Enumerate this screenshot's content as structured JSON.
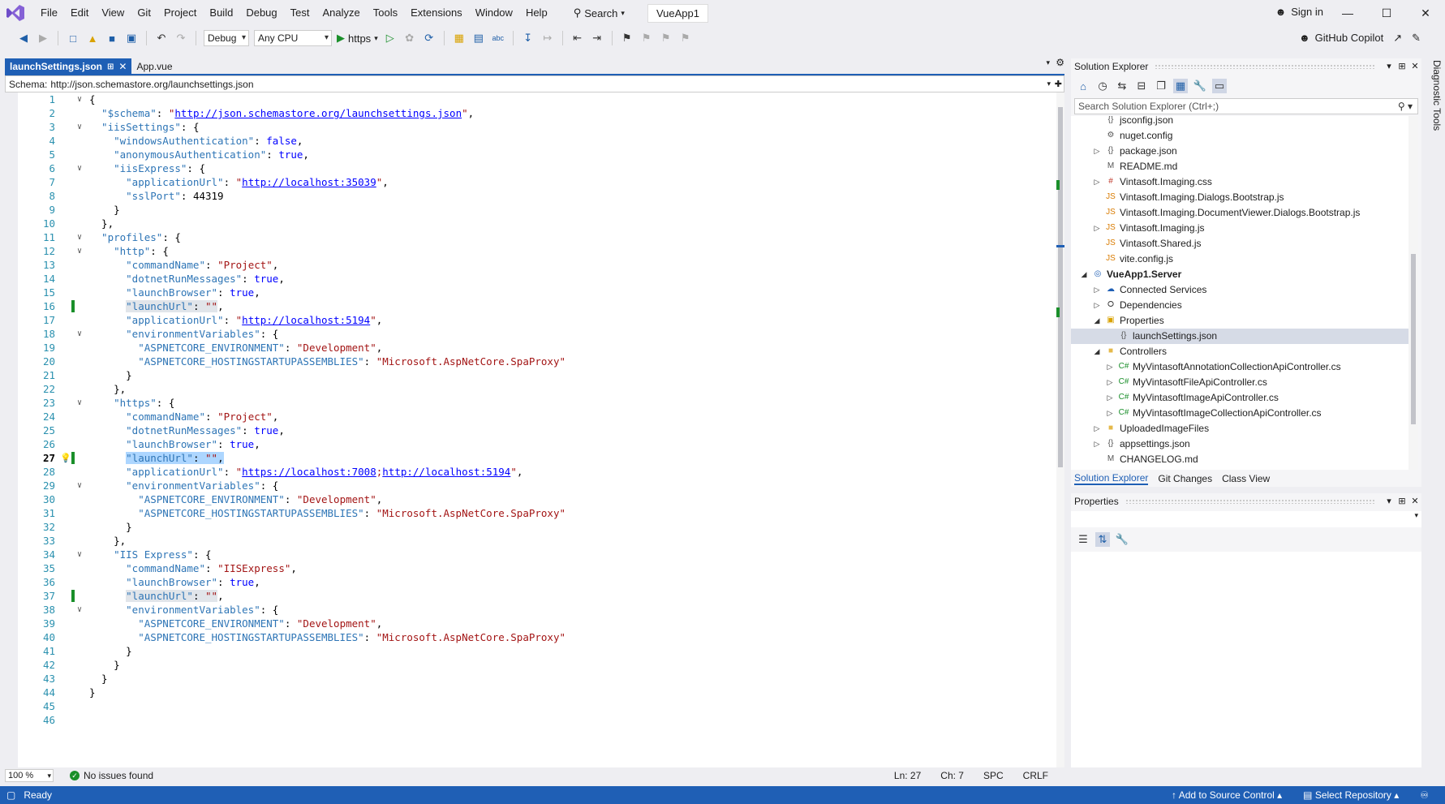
{
  "menu": [
    "File",
    "Edit",
    "View",
    "Git",
    "Project",
    "Build",
    "Debug",
    "Test",
    "Analyze",
    "Tools",
    "Extensions",
    "Window",
    "Help"
  ],
  "search_label": "Search",
  "solution_name": "VueApp1",
  "sign_in": "Sign in",
  "toolbar": {
    "config": "Debug",
    "platform": "Any CPU",
    "run_profile": "https",
    "copilot": "GitHub Copilot"
  },
  "tabs": [
    {
      "label": "launchSettings.json",
      "active": true
    },
    {
      "label": "App.vue",
      "active": false
    }
  ],
  "schema": {
    "label": "Schema:",
    "value": "http://json.schemastore.org/launchsettings.json"
  },
  "code_lines": [
    [
      [
        "p",
        "{"
      ]
    ],
    [
      [
        "k",
        "  \"$schema\""
      ],
      [
        "p",
        ": "
      ],
      [
        "s",
        "\""
      ],
      [
        "lnk",
        "http://json.schemastore.org/launchsettings.json"
      ],
      [
        "s",
        "\""
      ],
      [
        "p",
        ","
      ]
    ],
    [
      [
        "k",
        "  \"iisSettings\""
      ],
      [
        "p",
        ": {"
      ]
    ],
    [
      [
        "k",
        "    \"windowsAuthentication\""
      ],
      [
        "p",
        ": "
      ],
      [
        "lit",
        "false"
      ],
      [
        "p",
        ","
      ]
    ],
    [
      [
        "k",
        "    \"anonymousAuthentication\""
      ],
      [
        "p",
        ": "
      ],
      [
        "lit",
        "true"
      ],
      [
        "p",
        ","
      ]
    ],
    [
      [
        "k",
        "    \"iisExpress\""
      ],
      [
        "p",
        ": {"
      ]
    ],
    [
      [
        "k",
        "      \"applicationUrl\""
      ],
      [
        "p",
        ": "
      ],
      [
        "s",
        "\""
      ],
      [
        "lnk",
        "http://localhost:35039"
      ],
      [
        "s",
        "\""
      ],
      [
        "p",
        ","
      ]
    ],
    [
      [
        "k",
        "      \"sslPort\""
      ],
      [
        "p",
        ": 44319"
      ]
    ],
    [
      [
        "p",
        "    }"
      ]
    ],
    [
      [
        "p",
        "  },"
      ]
    ],
    [
      [
        "k",
        "  \"profiles\""
      ],
      [
        "p",
        ": {"
      ]
    ],
    [
      [
        "k",
        "    \"http\""
      ],
      [
        "p",
        ": {"
      ]
    ],
    [
      [
        "k",
        "      \"commandName\""
      ],
      [
        "p",
        ": "
      ],
      [
        "s",
        "\"Project\""
      ],
      [
        "p",
        ","
      ]
    ],
    [
      [
        "k",
        "      \"dotnetRunMessages\""
      ],
      [
        "p",
        ": "
      ],
      [
        "lit",
        "true"
      ],
      [
        "p",
        ","
      ]
    ],
    [
      [
        "k",
        "      \"launchBrowser\""
      ],
      [
        "p",
        ": "
      ],
      [
        "lit",
        "true"
      ],
      [
        "p",
        ","
      ]
    ],
    [
      [
        "p",
        "      "
      ],
      [
        "khl",
        "\"launchUrl\""
      ],
      [
        "phl",
        ": "
      ],
      [
        "shl",
        "\"\""
      ],
      [
        "p",
        ","
      ]
    ],
    [
      [
        "k",
        "      \"applicationUrl\""
      ],
      [
        "p",
        ": "
      ],
      [
        "s",
        "\""
      ],
      [
        "lnk",
        "http://localhost:5194"
      ],
      [
        "s",
        "\""
      ],
      [
        "p",
        ","
      ]
    ],
    [
      [
        "k",
        "      \"environmentVariables\""
      ],
      [
        "p",
        ": {"
      ]
    ],
    [
      [
        "k",
        "        \"ASPNETCORE_ENVIRONMENT\""
      ],
      [
        "p",
        ": "
      ],
      [
        "s",
        "\"Development\""
      ],
      [
        "p",
        ","
      ]
    ],
    [
      [
        "k",
        "        \"ASPNETCORE_HOSTINGSTARTUPASSEMBLIES\""
      ],
      [
        "p",
        ": "
      ],
      [
        "s",
        "\"Microsoft.AspNetCore.SpaProxy\""
      ]
    ],
    [
      [
        "p",
        "      }"
      ]
    ],
    [
      [
        "p",
        "    },"
      ]
    ],
    [
      [
        "k",
        "    \"https\""
      ],
      [
        "p",
        ": {"
      ]
    ],
    [
      [
        "k",
        "      \"commandName\""
      ],
      [
        "p",
        ": "
      ],
      [
        "s",
        "\"Project\""
      ],
      [
        "p",
        ","
      ]
    ],
    [
      [
        "k",
        "      \"dotnetRunMessages\""
      ],
      [
        "p",
        ": "
      ],
      [
        "lit",
        "true"
      ],
      [
        "p",
        ","
      ]
    ],
    [
      [
        "k",
        "      \"launchBrowser\""
      ],
      [
        "p",
        ": "
      ],
      [
        "lit",
        "true"
      ],
      [
        "p",
        ","
      ]
    ],
    [
      [
        "p",
        "      "
      ],
      [
        "ksel",
        "\"launchUrl\""
      ],
      [
        "psel",
        ": "
      ],
      [
        "ssel",
        "\"\""
      ],
      [
        "psel",
        ","
      ]
    ],
    [
      [
        "k",
        "      \"applicationUrl\""
      ],
      [
        "p",
        ": "
      ],
      [
        "s",
        "\""
      ],
      [
        "lnk",
        "https://localhost:7008"
      ],
      [
        "s",
        ";"
      ],
      [
        "lnk",
        "http://localhost:5194"
      ],
      [
        "s",
        "\""
      ],
      [
        "p",
        ","
      ]
    ],
    [
      [
        "k",
        "      \"environmentVariables\""
      ],
      [
        "p",
        ": {"
      ]
    ],
    [
      [
        "k",
        "        \"ASPNETCORE_ENVIRONMENT\""
      ],
      [
        "p",
        ": "
      ],
      [
        "s",
        "\"Development\""
      ],
      [
        "p",
        ","
      ]
    ],
    [
      [
        "k",
        "        \"ASPNETCORE_HOSTINGSTARTUPASSEMBLIES\""
      ],
      [
        "p",
        ": "
      ],
      [
        "s",
        "\"Microsoft.AspNetCore.SpaProxy\""
      ]
    ],
    [
      [
        "p",
        "      }"
      ]
    ],
    [
      [
        "p",
        "    },"
      ]
    ],
    [
      [
        "k",
        "    \"IIS Express\""
      ],
      [
        "p",
        ": {"
      ]
    ],
    [
      [
        "k",
        "      \"commandName\""
      ],
      [
        "p",
        ": "
      ],
      [
        "s",
        "\"IISExpress\""
      ],
      [
        "p",
        ","
      ]
    ],
    [
      [
        "k",
        "      \"launchBrowser\""
      ],
      [
        "p",
        ": "
      ],
      [
        "lit",
        "true"
      ],
      [
        "p",
        ","
      ]
    ],
    [
      [
        "p",
        "      "
      ],
      [
        "khl",
        "\"launchUrl\""
      ],
      [
        "phl",
        ": "
      ],
      [
        "shl",
        "\"\""
      ],
      [
        "p",
        ","
      ]
    ],
    [
      [
        "k",
        "      \"environmentVariables\""
      ],
      [
        "p",
        ": {"
      ]
    ],
    [
      [
        "k",
        "        \"ASPNETCORE_ENVIRONMENT\""
      ],
      [
        "p",
        ": "
      ],
      [
        "s",
        "\"Development\""
      ],
      [
        "p",
        ","
      ]
    ],
    [
      [
        "k",
        "        \"ASPNETCORE_HOSTINGSTARTUPASSEMBLIES\""
      ],
      [
        "p",
        ": "
      ],
      [
        "s",
        "\"Microsoft.AspNetCore.SpaProxy\""
      ]
    ],
    [
      [
        "p",
        "      }"
      ]
    ],
    [
      [
        "p",
        "    }"
      ]
    ],
    [
      [
        "p",
        "  }"
      ]
    ],
    [
      [
        "p",
        "}"
      ]
    ],
    [],
    []
  ],
  "fold_lines": [
    1,
    3,
    6,
    11,
    12,
    18,
    23,
    29,
    34,
    38
  ],
  "changed_lines": [
    16,
    27,
    37
  ],
  "current_line": 27,
  "editor_status": {
    "zoom": "100 %",
    "issues": "No issues found",
    "ln": "Ln: 27",
    "ch": "Ch: 7",
    "spc": "SPC",
    "crlf": "CRLF"
  },
  "solution_explorer": {
    "title": "Solution Explorer",
    "search_placeholder": "Search Solution Explorer (Ctrl+;)",
    "tree": [
      {
        "label": "jsconfig.json",
        "level": 2,
        "icon": "json-file-icon",
        "exp": ""
      },
      {
        "label": "nuget.config",
        "level": 2,
        "icon": "config-file-icon",
        "exp": ""
      },
      {
        "label": "package.json",
        "level": 2,
        "icon": "json-file-icon",
        "exp": "▷"
      },
      {
        "label": "README.md",
        "level": 2,
        "icon": "markdown-file-icon",
        "exp": ""
      },
      {
        "label": "Vintasoft.Imaging.css",
        "level": 2,
        "icon": "css-file-icon",
        "exp": "▷"
      },
      {
        "label": "Vintasoft.Imaging.Dialogs.Bootstrap.js",
        "level": 2,
        "icon": "js-file-icon",
        "exp": ""
      },
      {
        "label": "Vintasoft.Imaging.DocumentViewer.Dialogs.Bootstrap.js",
        "level": 2,
        "icon": "js-file-icon",
        "exp": ""
      },
      {
        "label": "Vintasoft.Imaging.js",
        "level": 2,
        "icon": "js-file-icon",
        "exp": "▷"
      },
      {
        "label": "Vintasoft.Shared.js",
        "level": 2,
        "icon": "js-file-icon",
        "exp": ""
      },
      {
        "label": "vite.config.js",
        "level": 2,
        "icon": "js-file-icon",
        "exp": ""
      },
      {
        "label": "VueApp1.Server",
        "level": 1,
        "icon": "web-project-icon",
        "exp": "◢",
        "bold": true
      },
      {
        "label": "Connected Services",
        "level": 2,
        "icon": "connected-services-icon",
        "exp": "▷"
      },
      {
        "label": "Dependencies",
        "level": 2,
        "icon": "dependencies-icon",
        "exp": "▷"
      },
      {
        "label": "Properties",
        "level": 2,
        "icon": "properties-folder-icon",
        "exp": "◢"
      },
      {
        "label": "launchSettings.json",
        "level": 3,
        "icon": "json-file-icon",
        "exp": "",
        "selected": true
      },
      {
        "label": "Controllers",
        "level": 2,
        "icon": "folder-icon",
        "exp": "◢"
      },
      {
        "label": "MyVintasoftAnnotationCollectionApiController.cs",
        "level": 3,
        "icon": "csharp-file-icon",
        "exp": "▷"
      },
      {
        "label": "MyVintasoftFileApiController.cs",
        "level": 3,
        "icon": "csharp-file-icon",
        "exp": "▷"
      },
      {
        "label": "MyVintasoftImageApiController.cs",
        "level": 3,
        "icon": "csharp-file-icon",
        "exp": "▷"
      },
      {
        "label": "MyVintasoftImageCollectionApiController.cs",
        "level": 3,
        "icon": "csharp-file-icon",
        "exp": "▷"
      },
      {
        "label": "UploadedImageFiles",
        "level": 2,
        "icon": "folder-icon",
        "exp": "▷"
      },
      {
        "label": "appsettings.json",
        "level": 2,
        "icon": "json-file-icon",
        "exp": "▷"
      },
      {
        "label": "CHANGELOG.md",
        "level": 2,
        "icon": "markdown-file-icon",
        "exp": ""
      }
    ],
    "tabs": [
      "Solution Explorer",
      "Git Changes",
      "Class View"
    ]
  },
  "properties": {
    "title": "Properties"
  },
  "diagnostic_tools": "Diagnostic Tools",
  "statusbar": {
    "ready": "Ready",
    "add_source": "Add to Source Control",
    "select_repo": "Select Repository"
  },
  "colors": {
    "accent": "#1f5fb5",
    "json_key": "#2e75b6",
    "json_string": "#a31515",
    "json_literal": "#0000ff",
    "line_number": "#2b91af",
    "change_marker": "#1a8f2a"
  }
}
